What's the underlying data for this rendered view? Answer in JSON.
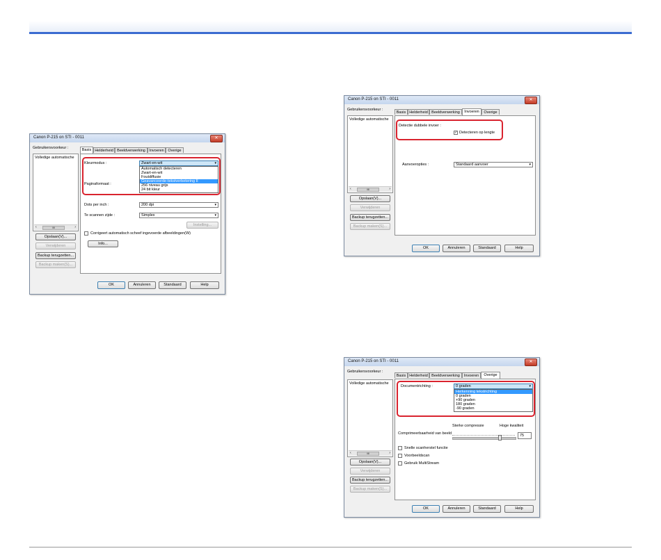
{
  "dialogs": [
    {
      "title": "Canon P-215 on STI - 0011",
      "close": "✕",
      "user_settings_label": "Gebruikersvoorkeur :",
      "list_item": "Volledige automatische",
      "scroll_left": "‹",
      "scroll_thumb": "III",
      "scroll_right": "›",
      "save_btn": "Opslaan(V)...",
      "delete_btn": "Verwijderen",
      "restore_btn": "Backup terugzetten...",
      "backup_btn": "Backup maken(S)...",
      "tabs": [
        "Basis",
        "Helderheid",
        "Beeldverwerking",
        "Invoeren",
        "Overige"
      ],
      "active_tab": "Basis",
      "colormode_label": "Kleurmodus :",
      "colormode_value": "Zwart-en-wit",
      "colormode_options": [
        "Automatisch detecteren",
        "Zwart-en-wit",
        "Foutdiffusie",
        "Geavanceerde-tekstverbetering II",
        "256 niveau grijs",
        "24 bit kleur"
      ],
      "colormode_selected": "Geavanceerde-tekstverbetering II",
      "pagesize_label": "Paginaformaat :",
      "dpi_label": "Dots per inch :",
      "dpi_value": "200 dpi",
      "side_label": "Te scannen zijde :",
      "side_value": "Simplex",
      "settings_btn": "Instelling...",
      "skew_label": "Corrigeert automatisch scheef ingevoerde afbeeldingen(W)",
      "info_btn": "Info...",
      "ok": "OK",
      "cancel": "Annuleren",
      "default": "Standaard",
      "help": "Help"
    },
    {
      "title": "Canon P-215 on STI - 0011",
      "close": "✕",
      "user_settings_label": "Gebruikersvoorkeur :",
      "list_item": "Volledige automatische",
      "scroll_left": "‹",
      "scroll_thumb": "III",
      "scroll_right": "›",
      "save_btn": "Opslaan(V)...",
      "delete_btn": "Verwijderen",
      "restore_btn": "Backup terugzetten...",
      "backup_btn": "Backup maken(S)...",
      "tabs": [
        "Basis",
        "Helderheid",
        "Beeldverwerking",
        "Invoeren",
        "Overige"
      ],
      "active_tab": "Invoeren",
      "double_feed_label": "Detectie dubbele invoer :",
      "detect_length_label": "Detecteren op lengte",
      "detect_length_checked": true,
      "feed_options_label": "Aanvoeropties :",
      "feed_options_value": "Standaard aanvoer",
      "ok": "OK",
      "cancel": "Annuleren",
      "default": "Standaard",
      "help": "Help"
    },
    {
      "title": "Canon P-215 on STI - 0011",
      "close": "✕",
      "user_settings_label": "Gebruikersvoorkeur :",
      "list_item": "Volledige automatische",
      "scroll_left": "‹",
      "scroll_thumb": "III",
      "scroll_right": "›",
      "save_btn": "Opslaan(V)...",
      "delete_btn": "Verwijderen",
      "restore_btn": "Backup terugzetten...",
      "backup_btn": "Backup maken(S)...",
      "tabs": [
        "Basis",
        "Helderheid",
        "Beeldverwerking",
        "Invoeren",
        "Overige"
      ],
      "active_tab": "Overige",
      "orientation_label": "Documentrichting :",
      "orientation_value": "0 graden",
      "orientation_options": [
        "Herkenning tekstrichting",
        "0 graden",
        "+90 graden",
        "180 graden",
        "-90 graden"
      ],
      "orientation_selected": "Herkenning tekstrichting",
      "strong_compression": "Sterke compressie",
      "high_quality": "Hoge kwaliteit",
      "compress_label": "Comprimeerbaarheid van beeld",
      "compress_value": "75",
      "compress_level": 0.75,
      "quick_recovery_label": "Snelle scanherstel functie",
      "prescan_label": "Voorbeeldscan",
      "multistream_label": "Gebruik MultiStream",
      "ok": "OK",
      "cancel": "Annuleren",
      "default": "Standaard",
      "help": "Help"
    }
  ]
}
